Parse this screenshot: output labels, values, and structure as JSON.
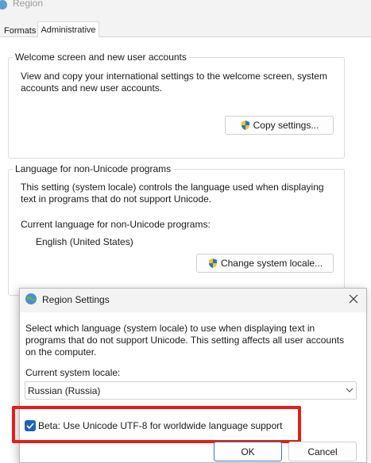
{
  "window": {
    "title": "Region",
    "tabs": [
      "Formats",
      "Administrative"
    ],
    "active_tab": "Administrative"
  },
  "welcome_group": {
    "title": "Welcome screen and new user accounts",
    "description": "View and copy your international settings to the welcome screen, system accounts and new user accounts.",
    "copy_button": "Copy settings..."
  },
  "unicode_group": {
    "title": "Language for non-Unicode programs",
    "description": "This setting (system locale) controls the language used when displaying text in programs that do not support Unicode.",
    "current_label": "Current language for non-Unicode programs:",
    "current_value": "English (United States)",
    "change_button": "Change system locale..."
  },
  "dialog": {
    "title": "Region Settings",
    "description": "Select which language (system locale) to use when displaying text in programs that do not support Unicode. This setting affects all user accounts on the computer.",
    "locale_label": "Current system locale:",
    "locale_value": "Russian (Russia)",
    "checkbox_label": "Beta: Use Unicode UTF-8 for worldwide language support",
    "checkbox_checked": true,
    "ok_button": "OK",
    "cancel_button": "Cancel"
  },
  "colors": {
    "highlight": "#e0201b",
    "checkbox": "#1f63b8"
  }
}
